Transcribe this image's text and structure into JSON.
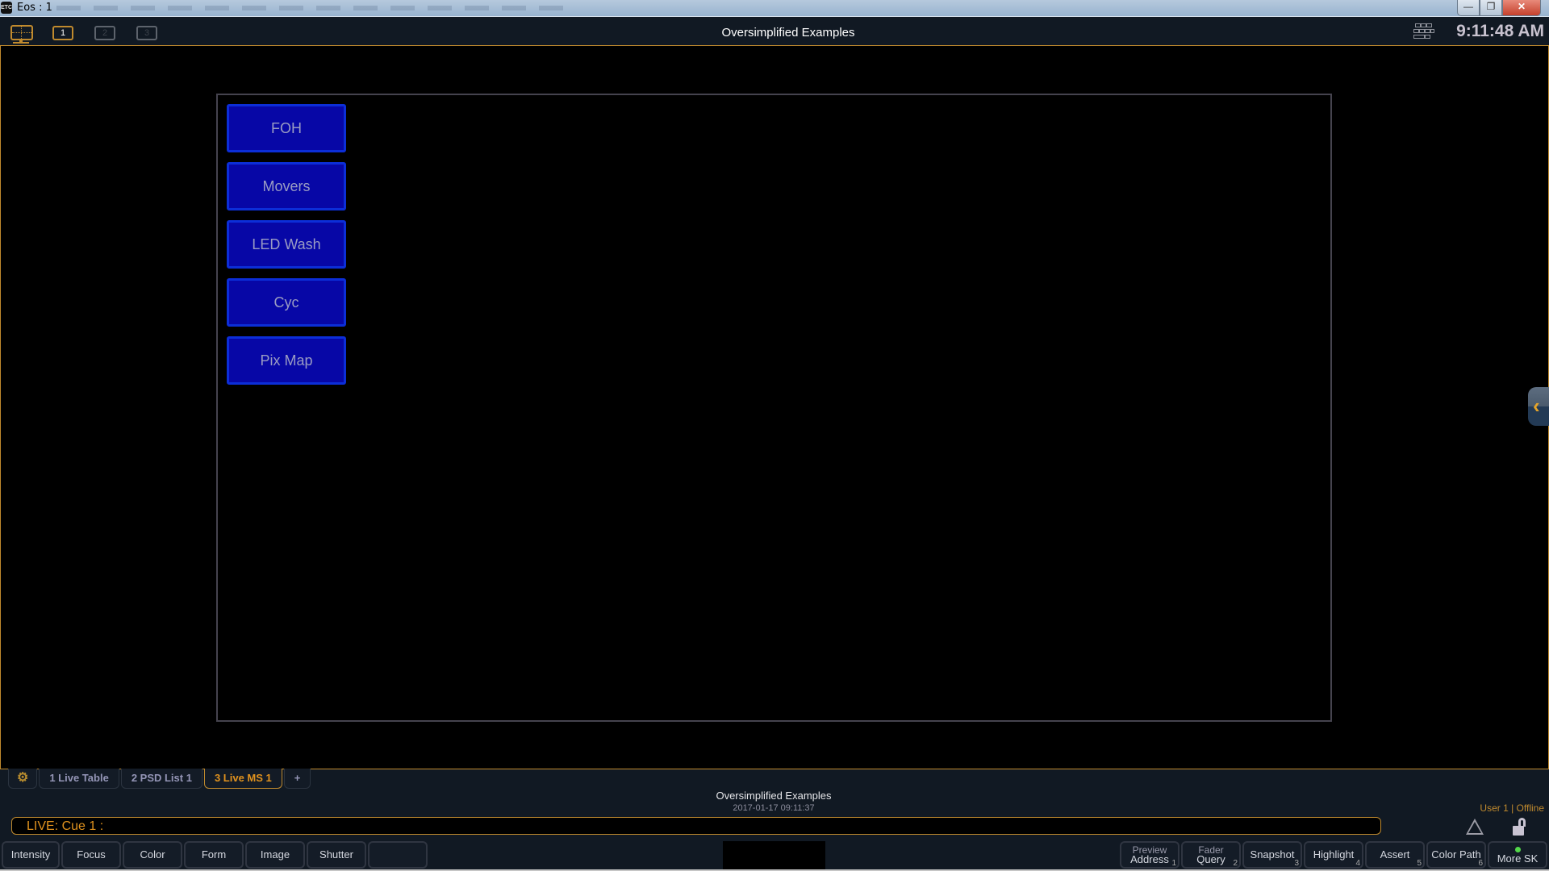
{
  "window": {
    "title": "Eos : 1",
    "logo_text": "ETC",
    "controls": {
      "minimize": "—",
      "restore": "❐",
      "close": "✕"
    }
  },
  "appbar": {
    "display_icon": "monitor-grid-icon",
    "pages": [
      {
        "label": "1",
        "active": true
      },
      {
        "label": "2",
        "active": false
      },
      {
        "label": "3",
        "active": false
      }
    ],
    "title": "Oversimplified Examples",
    "keyboard_icon": "keyboard-icon",
    "clock": "9:11:48 AM"
  },
  "magic_sheet": {
    "buttons": [
      "FOH",
      "Movers",
      "LED Wash",
      "Cyc",
      "Pix Map"
    ],
    "colors": {
      "fill": "#0707a6",
      "border": "#0c2ed8",
      "text": "#9a9cc3"
    }
  },
  "side_tab": {
    "icon": "chevron-left-icon",
    "glyph": "‹"
  },
  "tabs": [
    {
      "label": "⚙",
      "icon": "gear-icon",
      "active": false
    },
    {
      "label": "1 Live Table",
      "active": false
    },
    {
      "label": "2 PSD List 1",
      "active": false
    },
    {
      "label": "3 Live MS 1",
      "active": true
    },
    {
      "label": "+",
      "active": false
    }
  ],
  "status": {
    "show_name": "Oversimplified Examples",
    "datetime": "2017-01-17 09:11:37",
    "user": "User 1 | Offline"
  },
  "command_line": "LIVE: Cue  1 :",
  "softkeys_left": [
    "Intensity",
    "Focus",
    "Color",
    "Form",
    "Image",
    "Shutter",
    ""
  ],
  "softkeys_right": [
    {
      "top": "Preview",
      "label": "Address",
      "num": "1"
    },
    {
      "top": "Fader",
      "label": "Query",
      "num": "2"
    },
    {
      "top": "",
      "label": "Snapshot",
      "num": "3"
    },
    {
      "top": "",
      "label": "Highlight",
      "num": "4"
    },
    {
      "top": "",
      "label": "Assert",
      "num": "5"
    },
    {
      "top": "",
      "label": "Color Path",
      "num": "6"
    },
    {
      "top": "",
      "label": "More SK",
      "num": "",
      "led": true
    }
  ],
  "accent_colors": {
    "orange": "#c08a2e",
    "active_tab": "#e0921e",
    "background": "#111923"
  }
}
